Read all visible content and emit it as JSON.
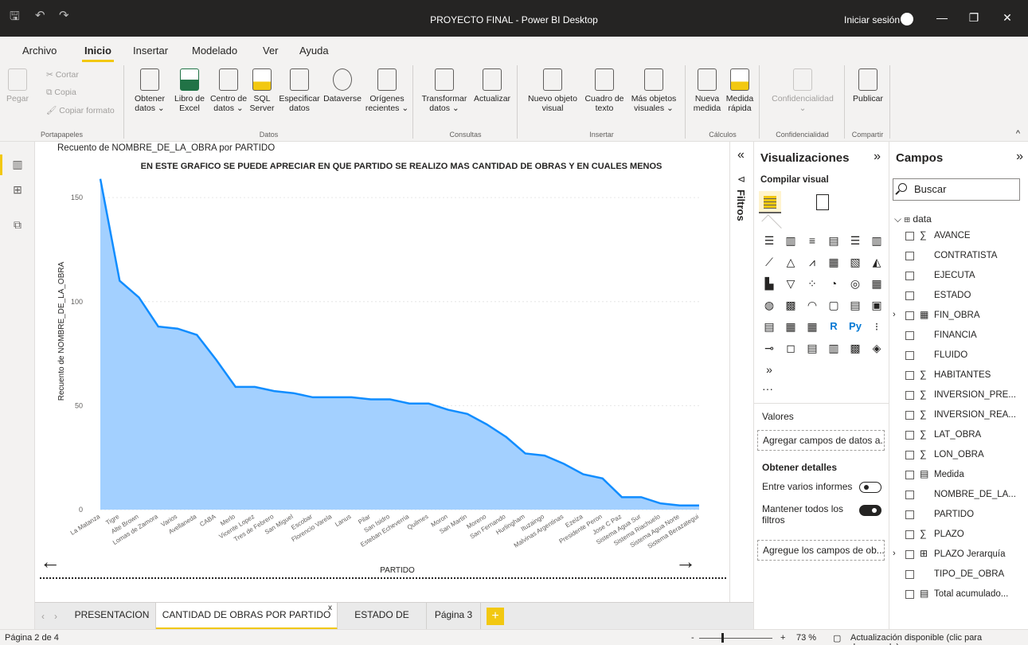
{
  "window": {
    "title": "PROYECTO FINAL - Power BI Desktop",
    "signin": "Iniciar sesión"
  },
  "menu": {
    "tabs": [
      "Archivo",
      "Inicio",
      "Insertar",
      "Modelado",
      "Ver",
      "Ayuda"
    ],
    "active": "Inicio"
  },
  "ribbon": {
    "portapapeles": {
      "paste": "Pegar",
      "cut": "Cortar",
      "copy": "Copia",
      "format": "Copiar formato",
      "label": "Portapapeles"
    },
    "datos": {
      "label": "Datos",
      "buttons": [
        [
          "Obtener",
          "datos ⌄"
        ],
        [
          "Libro de",
          "Excel"
        ],
        [
          "Centro de",
          "datos ⌄"
        ],
        [
          "SQL",
          "Server"
        ],
        [
          "Especificar",
          "datos"
        ],
        [
          "Dataverse",
          ""
        ],
        [
          "Orígenes",
          "recientes ⌄"
        ]
      ]
    },
    "consultas": {
      "label": "Consultas",
      "buttons": [
        [
          "Transformar",
          "datos ⌄"
        ],
        [
          "Actualizar",
          ""
        ]
      ]
    },
    "insertar": {
      "label": "Insertar",
      "buttons": [
        [
          "Nuevo objeto",
          "visual"
        ],
        [
          "Cuadro de",
          "texto"
        ],
        [
          "Más objetos",
          "visuales ⌄"
        ]
      ]
    },
    "calculos": {
      "label": "Cálculos",
      "buttons": [
        [
          "Nueva",
          "medida"
        ],
        [
          "Medida",
          "rápida"
        ]
      ]
    },
    "confidencialidad": {
      "label": "Confidencialidad",
      "buttons": [
        [
          "Confidencialidad",
          "⌄"
        ]
      ]
    },
    "compartir": {
      "label": "Compartir",
      "buttons": [
        [
          "Publicar",
          ""
        ]
      ]
    }
  },
  "chart_data": {
    "type": "area",
    "header": "Recuento de NOMBRE_DE_LA_OBRA por PARTIDO",
    "title": "EN ESTE GRAFICO SE PUEDE APRECIAR EN QUE PARTIDO SE REALIZO MAS CANTIDAD DE OBRAS Y EN CUALES MENOS",
    "xlabel": "PARTIDO",
    "ylabel": "Recuento de NOMBRE_DE_LA_OBRA",
    "ylim": [
      0,
      160
    ],
    "yticks": [
      0,
      50,
      100,
      150
    ],
    "color": "#118dff",
    "categories": [
      "La Matanza",
      "Tigre",
      "Alte Brown",
      "Lomas de Zamora",
      "Varios",
      "Avellaneda",
      "CABA",
      "Merlo",
      "Vicente Lopez",
      "Tres de Febrero",
      "San Miguel",
      "Escobar",
      "Florencio Varela",
      "Lanus",
      "Pilar",
      "San Isidro",
      "Esteban Echeverria",
      "Quilmes",
      "Moron",
      "San Martin",
      "Moreno",
      "San Fernando",
      "Hurlingham",
      "Ituzaingo",
      "Malvinas Argentinas",
      "Ezeiza",
      "Presidente Peron",
      "Jose C Paz",
      "Sistema Agua Sur",
      "Sistema Riachuelo",
      "Sistema Agua Norte",
      "Sistema Berazategui"
    ],
    "values": [
      159,
      110,
      102,
      88,
      87,
      84,
      72,
      59,
      59,
      57,
      56,
      54,
      54,
      54,
      53,
      53,
      51,
      51,
      48,
      46,
      41,
      35,
      27,
      26,
      22,
      17,
      15,
      6,
      6,
      3,
      2,
      2
    ]
  },
  "pages": {
    "tabs": [
      "PRESENTACION",
      "CANTIDAD DE OBRAS POR PARTIDO",
      "ESTADO DE OBRAS",
      "Página 3"
    ],
    "active": 1,
    "add": "+"
  },
  "status": {
    "page": "Página 2 de 4",
    "zoom": "73 %",
    "update": "Actualización disponible (clic para descargarla)"
  },
  "filters": {
    "label": "Filtros"
  },
  "viz": {
    "title": "Visualizaciones",
    "build": "Compilar visual",
    "values": "Valores",
    "values_drop": "Agregar campos de datos a...",
    "drill": "Obtener detalles",
    "cross": "Entre varios informes",
    "keep": "Mantener todos los filtros",
    "drill_drop": "Agregue los campos de ob...",
    "more": "···"
  },
  "fields": {
    "title": "Campos",
    "search_placeholder": "Buscar",
    "table": "data",
    "items": [
      {
        "icon": "∑",
        "name": "AVANCE"
      },
      {
        "icon": "",
        "name": "CONTRATISTA"
      },
      {
        "icon": "",
        "name": "EJECUTA"
      },
      {
        "icon": "",
        "name": "ESTADO"
      },
      {
        "icon": "▦",
        "name": "FIN_OBRA",
        "expand": "›"
      },
      {
        "icon": "",
        "name": "FINANCIA"
      },
      {
        "icon": "",
        "name": "FLUIDO"
      },
      {
        "icon": "∑",
        "name": "HABITANTES"
      },
      {
        "icon": "∑",
        "name": "INVERSION_PRE..."
      },
      {
        "icon": "∑",
        "name": "INVERSION_REA..."
      },
      {
        "icon": "∑",
        "name": "LAT_OBRA"
      },
      {
        "icon": "∑",
        "name": "LON_OBRA"
      },
      {
        "icon": "▤",
        "name": "Medida"
      },
      {
        "icon": "",
        "name": "NOMBRE_DE_LA..."
      },
      {
        "icon": "",
        "name": "PARTIDO"
      },
      {
        "icon": "∑",
        "name": "PLAZO"
      },
      {
        "icon": "⊞",
        "name": "PLAZO Jerarquía",
        "expand": "›"
      },
      {
        "icon": "",
        "name": "TIPO_DE_OBRA"
      },
      {
        "icon": "▤",
        "name": "Total acumulado..."
      }
    ]
  }
}
